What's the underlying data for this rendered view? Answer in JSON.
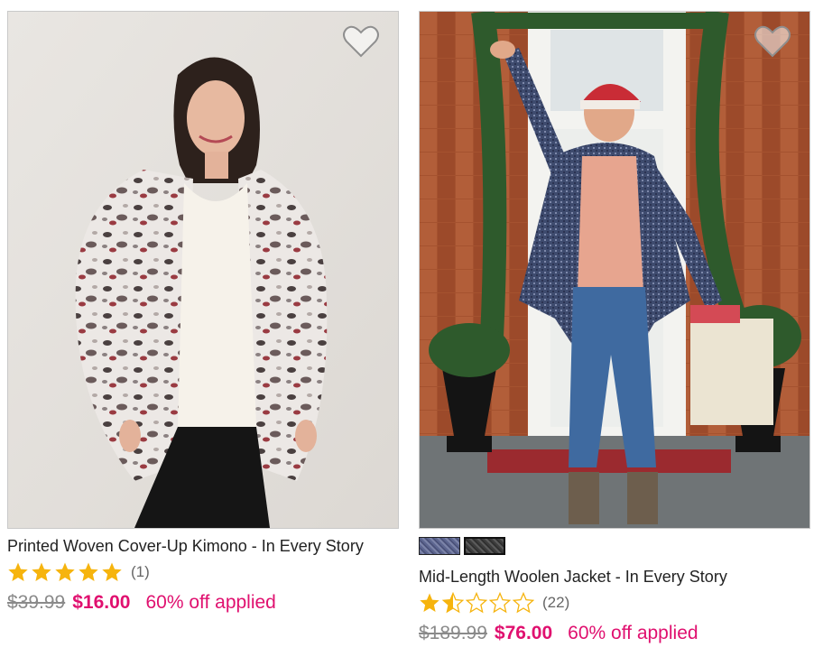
{
  "products": [
    {
      "name": "Printed Woven Cover-Up Kimono - In Every Story",
      "rating": 5,
      "review_count": "(1)",
      "old_price": "$39.99",
      "new_price": "$16.00",
      "promo": "60% off applied",
      "swatches": []
    },
    {
      "name": "Mid-Length Woolen Jacket - In Every Story",
      "rating": 1.5,
      "review_count": "(22)",
      "old_price": "$189.99",
      "new_price": "$76.00",
      "promo": "60% off applied",
      "swatches": [
        "navy",
        "charcoal"
      ]
    }
  ],
  "icons": {
    "wishlist": "heart-outline-icon",
    "star_full": "star-filled-icon",
    "star_half": "star-half-icon",
    "star_empty": "star-empty-icon"
  },
  "colors": {
    "sale": "#e0106f",
    "star": "#f6b40e",
    "old_price": "#8a8a8a"
  }
}
